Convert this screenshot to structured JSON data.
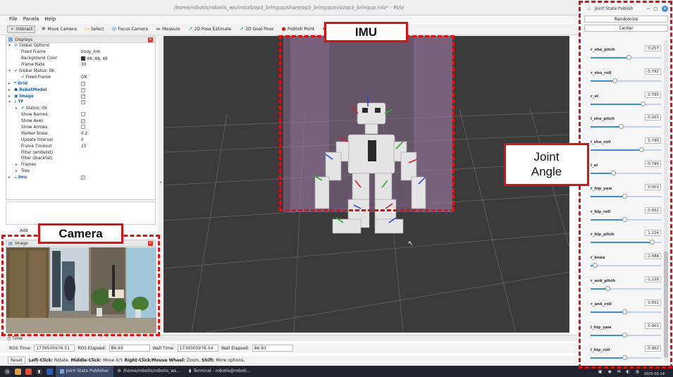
{
  "window": {
    "title": "/home/robotis/robotis_ws/install/op3_bringup/share/op3_bringup/rviz/op3_bringup.rviz* - RViz"
  },
  "menu": [
    "File",
    "Panels",
    "Help"
  ],
  "toolbar": [
    {
      "label": "Interact",
      "icon": "interact-icon",
      "active": true
    },
    {
      "label": "Move Camera",
      "icon": "move-camera-icon"
    },
    {
      "label": "Select",
      "icon": "select-icon"
    },
    {
      "label": "Focus Camera",
      "icon": "focus-camera-icon"
    },
    {
      "label": "Measure",
      "icon": "measure-icon"
    },
    {
      "label": "2D Pose Estimate",
      "icon": "pose-estimate-icon"
    },
    {
      "label": "2D Goal Pose",
      "icon": "goal-pose-icon"
    },
    {
      "label": "Publish Point",
      "icon": "publish-point-icon"
    }
  ],
  "displays": {
    "title": "Displays",
    "rows": [
      {
        "indent": 0,
        "expander": "▾",
        "icon": "gear-icon",
        "label": "Global Options",
        "value": ""
      },
      {
        "indent": 1,
        "label": "Fixed Frame",
        "value": "body_link"
      },
      {
        "indent": 1,
        "label": "Background Color",
        "value": "48; 48; 48",
        "swatch": "#303030"
      },
      {
        "indent": 1,
        "label": "Frame Rate",
        "value": "30"
      },
      {
        "indent": 0,
        "expander": "▾",
        "icon": "check-icon",
        "label": "Global Status: Ok",
        "value": ""
      },
      {
        "indent": 1,
        "icon": "check-icon",
        "label": "Fixed Frame",
        "value": "OK"
      },
      {
        "indent": 0,
        "expander": "▸",
        "icon": "grid-icon",
        "label": "Grid",
        "bold": true,
        "checkbox": true
      },
      {
        "indent": 0,
        "expander": "▸",
        "icon": "robot-icon",
        "label": "RobotModel",
        "bold": true,
        "checkbox": true
      },
      {
        "indent": 0,
        "expander": "▸",
        "icon": "image-icon",
        "label": "Image",
        "bold": true,
        "checkbox": true
      },
      {
        "indent": 0,
        "expander": "▾",
        "icon": "tf-icon",
        "label": "TF",
        "bold": true,
        "checkbox": true
      },
      {
        "indent": 1,
        "expander": "▸",
        "icon": "check-icon",
        "label": "Status: Ok",
        "value": ""
      },
      {
        "indent": 1,
        "label": "Show Names",
        "checkbox": false
      },
      {
        "indent": 1,
        "label": "Show Axes",
        "checkbox": true
      },
      {
        "indent": 1,
        "label": "Show Arrows",
        "checkbox": false
      },
      {
        "indent": 1,
        "label": "Marker Scale",
        "value": "0.2"
      },
      {
        "indent": 1,
        "label": "Update Interval",
        "value": "0"
      },
      {
        "indent": 1,
        "label": "Frame Timeout",
        "value": "15"
      },
      {
        "indent": 1,
        "label": "Filter (whitelist)",
        "value": ""
      },
      {
        "indent": 1,
        "label": "Filter (blacklist)",
        "value": ""
      },
      {
        "indent": 1,
        "expander": "▸",
        "label": "Frames",
        "value": ""
      },
      {
        "indent": 1,
        "expander": "▸",
        "label": "Tree",
        "value": ""
      },
      {
        "indent": 0,
        "expander": "▸",
        "icon": "imu-icon",
        "label": "Imu",
        "bold": true,
        "checkbox": true
      }
    ],
    "add_button": "Add"
  },
  "image_panel": {
    "title": "Image"
  },
  "time_panel": {
    "title": "Time",
    "ros_time_label": "ROS Time:",
    "ros_time": "1739505976.51",
    "ros_elapsed_label": "ROS Elapsed:",
    "ros_elapsed": "86.93",
    "wall_time_label": "Wall Time:",
    "wall_time": "1739505976.54",
    "wall_elapsed_label": "Wall Elapsed:",
    "wall_elapsed": "86.93"
  },
  "status": {
    "reset": "Reset",
    "hint_left_bold": "Left-Click:",
    "hint_left": "Rotate.",
    "hint_middle_bold": "Middle-Click:",
    "hint_middle": "Move X/Y.",
    "hint_right_bold": "Right-Click/Mouse Wheel:",
    "hint_right": "Zoom.",
    "hint_shift_bold": "Shift:",
    "hint_shift": "More options."
  },
  "taskbar": {
    "items": [
      {
        "label": "Joint State Publisher",
        "active": true
      },
      {
        "label": "/home/robotis/robotis_ws..."
      },
      {
        "label": "Terminal - robotis@roboti..."
      }
    ],
    "date": "2025-02-14"
  },
  "jsp": {
    "title": "Joint State Publish",
    "randomize": "Randomize",
    "center": "Center",
    "joints": [
      {
        "name": "r_sho_pitch",
        "value": "0.257",
        "pos": 0.54
      },
      {
        "name": "r_sho_roll",
        "value": "-0.792",
        "pos": 0.33
      },
      {
        "name": "r_el",
        "value": "0.785",
        "pos": 0.75
      },
      {
        "name": "l_sho_pitch",
        "value": "-0.261",
        "pos": 0.42
      },
      {
        "name": "l_sho_roll",
        "value": "0.790",
        "pos": 0.73
      },
      {
        "name": "l_el",
        "value": "-0.789",
        "pos": 0.3
      },
      {
        "name": "r_hip_yaw",
        "value": "0.001",
        "pos": 0.47
      },
      {
        "name": "r_hip_roll",
        "value": "-0.002",
        "pos": 0.47
      },
      {
        "name": "r_hip_pitch",
        "value": "1.224",
        "pos": 0.88
      },
      {
        "name": "r_knee",
        "value": "-2.484",
        "pos": 0.03
      },
      {
        "name": "r_ank_pitch",
        "value": "-1.228",
        "pos": 0.22
      },
      {
        "name": "r_ank_roll",
        "value": "0.001",
        "pos": 0.47
      },
      {
        "name": "l_hip_yaw",
        "value": "0.001",
        "pos": 0.47
      },
      {
        "name": "l_hip_roll",
        "value": "-0.002",
        "pos": 0.47
      }
    ]
  },
  "annotations": {
    "imu": "IMU",
    "camera": "Camera",
    "joint_angle_1": "Joint",
    "joint_angle_2": "Angle"
  },
  "colors": {
    "accent": "#e01010",
    "viewport_bg": "#303030",
    "slider": "#3b8ed8"
  }
}
